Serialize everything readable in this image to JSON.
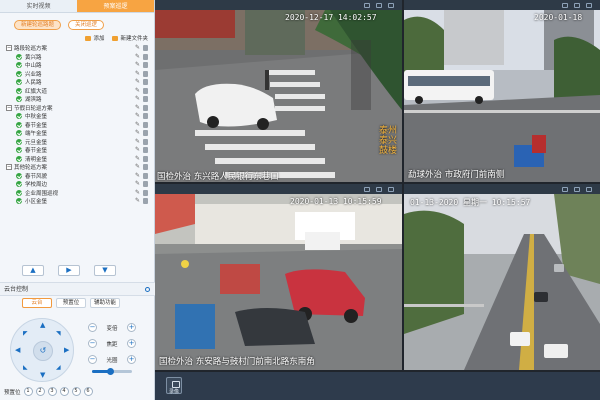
{
  "tabs": [
    "实时视频",
    "预案巡逻"
  ],
  "buttons": {
    "new_plan": "新建轮巡路题",
    "close_plan": "关闭巡逻"
  },
  "toolbar": {
    "add": "添加",
    "new_folder": "新建文件夹"
  },
  "tree": [
    {
      "label": "路段轮巡方案",
      "items": [
        "黄兴路",
        "中山路",
        "兴业路",
        "人民路",
        "红旗大道",
        "湖滨路"
      ]
    },
    {
      "label": "节假日轮巡方案",
      "items": [
        "中秋金堡",
        "春节金堡",
        "端午金堡",
        "元旦金堡",
        "春节金堡",
        "清明金堡"
      ]
    },
    {
      "label": "其他轮巡方案",
      "items": [
        "春节风貌",
        "学校周边",
        "企业周围巡视",
        "小区金堡"
      ]
    }
  ],
  "nav": {
    "up": "▲",
    "play": "▶",
    "down": "▼"
  },
  "ptz": {
    "section_title": "云台控制",
    "tabs": [
      "云台",
      "预置位",
      "辅助功能"
    ],
    "controls": [
      {
        "label": "变倍",
        "minus": "−",
        "plus": "+"
      },
      {
        "label": "焦距",
        "minus": "−",
        "plus": "+"
      },
      {
        "label": "光圈",
        "minus": "−",
        "plus": "+"
      }
    ],
    "speed": 0.45,
    "preset_label": "预置位",
    "presets": [
      "1",
      "2",
      "3",
      "4",
      "5",
      "6"
    ],
    "joystick_center": "↺"
  },
  "videos": [
    {
      "time": "2020-12-17  14:02:57",
      "location": "国检外治     东兴路人民银行东巷口",
      "side": "泰州\n泰兴\n鼓楼"
    },
    {
      "time": "2020-01-18",
      "location": "勐球外治         市政府门前南侧"
    },
    {
      "time": "2020-01-13  10:15:59",
      "location": "国检外治    东安路与鼓村门前南北路东南角"
    },
    {
      "time": "01-13-2020  星期一  10:15:57",
      "location": ""
    }
  ],
  "record_label": "录像",
  "colors": {
    "accent": "#f7a442",
    "primary": "#1b6fc2",
    "online": "#35a542"
  }
}
